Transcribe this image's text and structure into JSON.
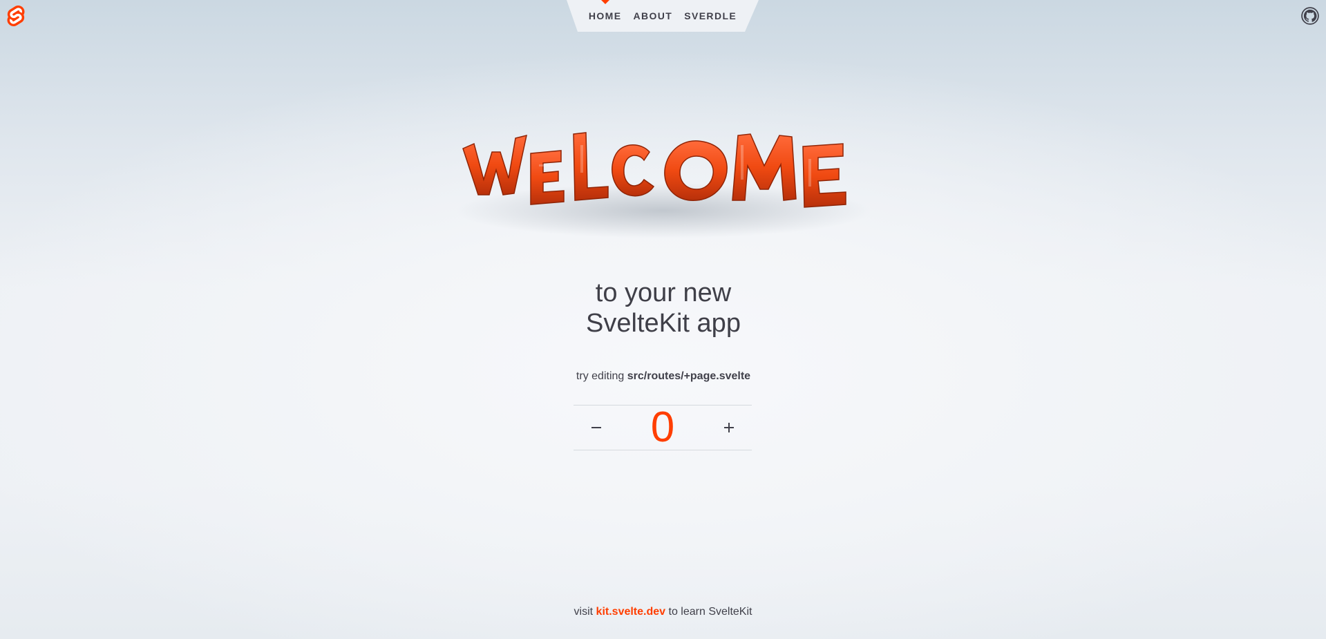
{
  "header": {
    "logo_icon": "svelte-logo-icon",
    "github_icon": "github-icon",
    "nav": [
      {
        "label": "Home",
        "active": true
      },
      {
        "label": "About",
        "active": false
      },
      {
        "label": "Sverdle",
        "active": false
      }
    ]
  },
  "hero": {
    "image_text": "WELCOME"
  },
  "main": {
    "subtitle_line1": "to your new",
    "subtitle_line2": "SvelteKit app",
    "hint_prefix": "try editing",
    "hint_path": "src/routes/+page.svelte",
    "counter": {
      "value": "0",
      "decrement_icon": "minus-icon",
      "increment_icon": "plus-icon"
    }
  },
  "footer": {
    "prefix": "visit",
    "link": "kit.svelte.dev",
    "suffix": "to learn SvelteKit"
  },
  "colors": {
    "accent": "#ff3e00",
    "text": "#40404a",
    "nav_bg": "#eef1f5"
  }
}
